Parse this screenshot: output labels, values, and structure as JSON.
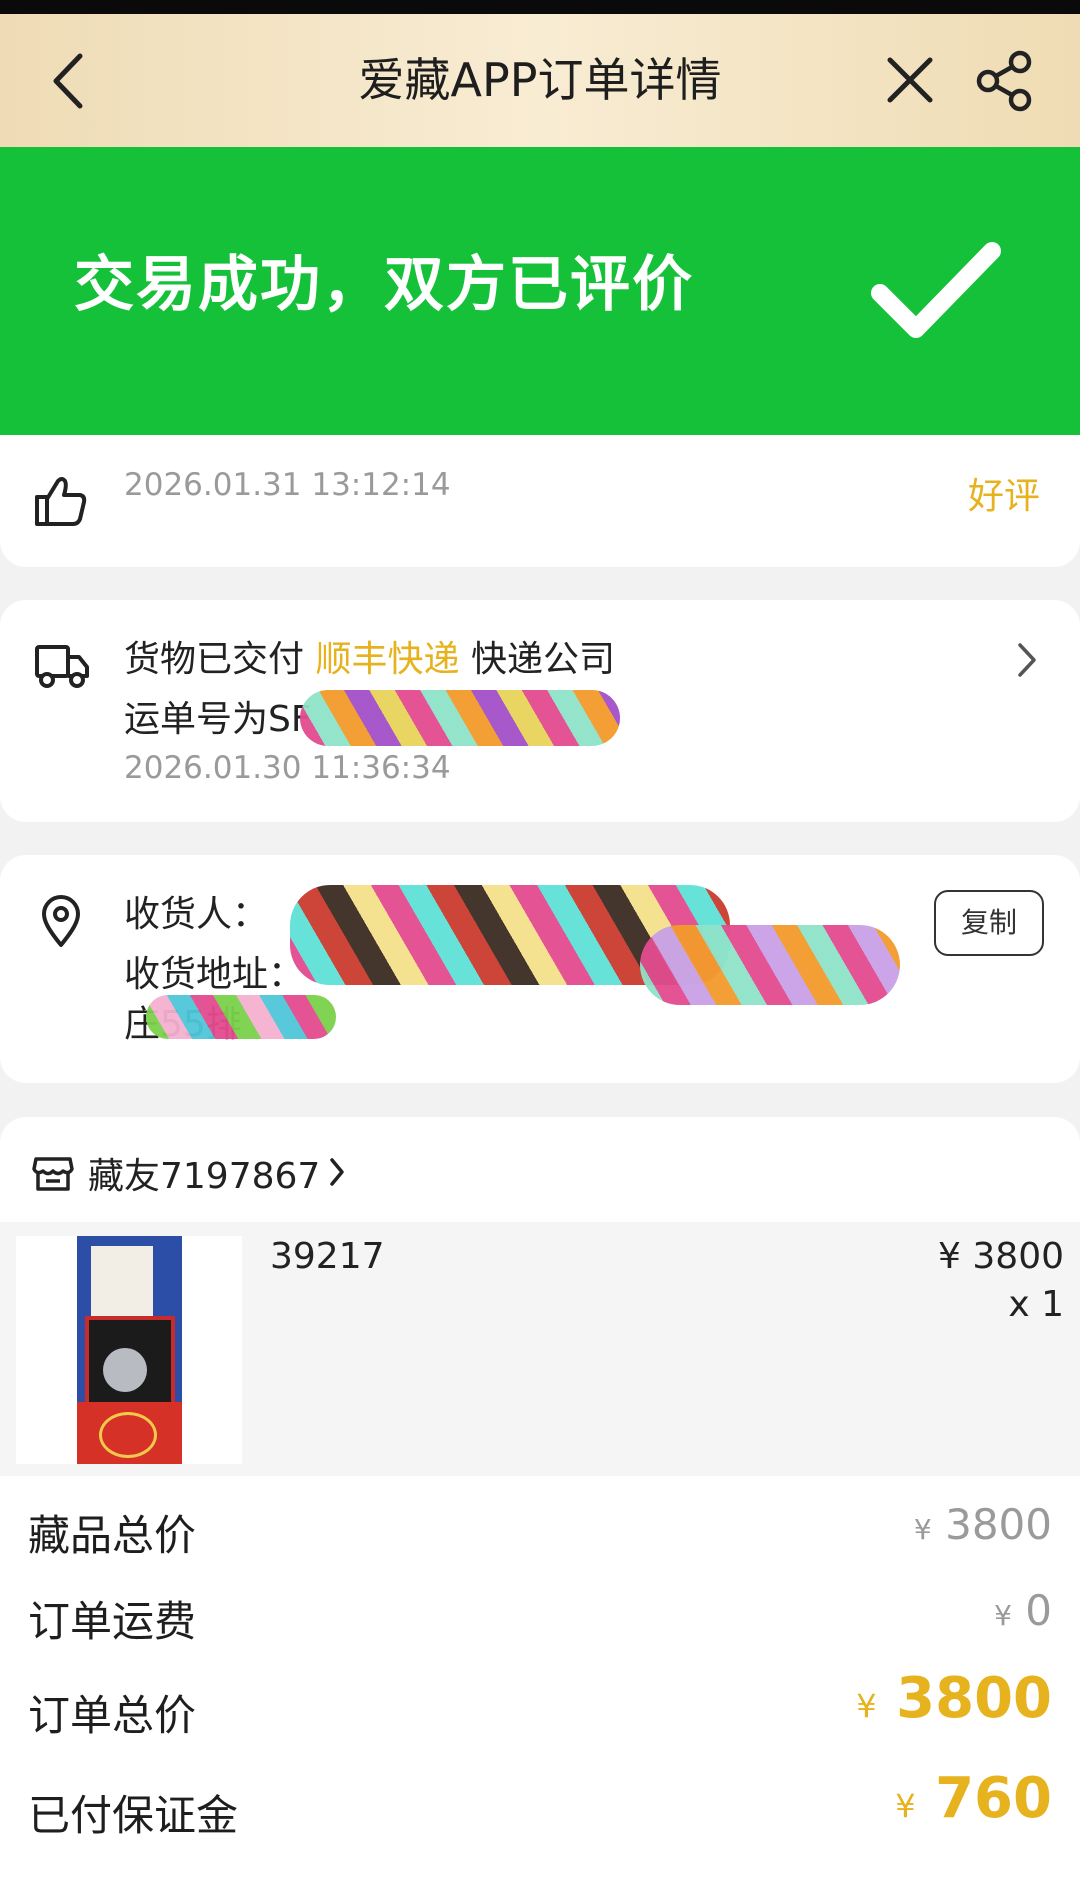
{
  "header": {
    "title": "爱藏APP订单详情",
    "back_icon": "back-arrow-icon",
    "close_icon": "close-icon",
    "share_icon": "share-icon"
  },
  "banner": {
    "message": "交易成功，双方已评价",
    "icon": "checkmark-icon",
    "color": "#16c13a"
  },
  "review": {
    "icon": "thumbs-up-icon",
    "time": "2026.01.31 13:12:14",
    "rating": "好评"
  },
  "shipping": {
    "icon": "truck-icon",
    "status_prefix": "货物已交付",
    "courier": "顺丰快递",
    "status_suffix": "快递公司",
    "tracking_label": "运单号为SF",
    "time": "2026.01.30 11:36:34",
    "chevron": "chevron-right-icon"
  },
  "address": {
    "icon": "location-pin-icon",
    "receiver_label": "收货人：",
    "address_label": "收货地址：",
    "address_tail": "庄55排",
    "copy_label": "复制"
  },
  "seller": {
    "icon": "shop-icon",
    "name": "藏友7197867"
  },
  "product": {
    "name": "39217",
    "price": "¥ 3800",
    "quantity": "x 1"
  },
  "summary": {
    "items_total_label": "藏品总价",
    "items_total_currency": "¥",
    "items_total_value": "3800",
    "shipping_fee_label": "订单运费",
    "shipping_fee_currency": "¥",
    "shipping_fee_value": "0",
    "order_total_label": "订单总价",
    "order_total_currency": "¥",
    "order_total_value": "3800",
    "deposit_label": "已付保证金",
    "deposit_currency": "¥",
    "deposit_value": "760"
  },
  "colors": {
    "accent_gold": "#e6b21d",
    "success_green": "#16c13a",
    "header_beige": "#f3e3c4"
  }
}
